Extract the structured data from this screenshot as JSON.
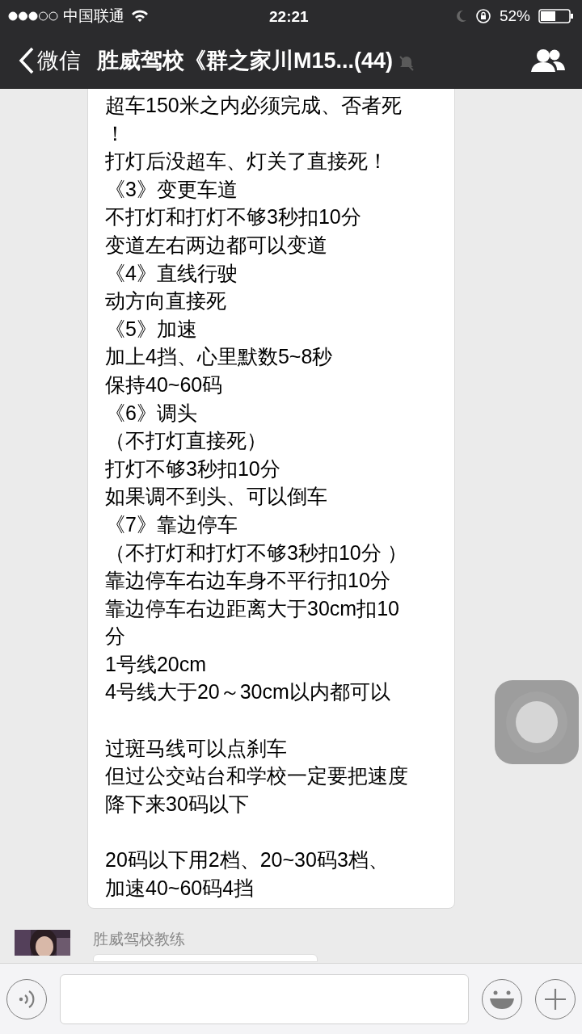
{
  "status_bar": {
    "carrier": "中国联通",
    "time": "22:21",
    "battery": "52%"
  },
  "header": {
    "back": "微信",
    "title": "胜威驾校《群之家川M15...(44)",
    "muted": true
  },
  "message": {
    "paragraphs": [
      [
        "超车150米之内必须完成、否者死",
        "！",
        "打灯后没超车、灯关了直接死！",
        "《3》变更车道",
        "不打灯和打灯不够3秒扣10分",
        "变道左右两边都可以变道",
        "《4》直线行驶",
        "动方向直接死",
        "《5》加速",
        "加上4挡、心里默数5~8秒",
        "保持40~60码",
        "《6》调头",
        "（不打灯直接死）",
        "打灯不够3秒扣10分",
        "如果调不到头、可以倒车",
        "《7》靠边停车",
        "（不打灯和打灯不够3秒扣10分 ）",
        "靠边停车右边车身不平行扣10分",
        "靠边停车右边距离大于30cm扣10",
        "分",
        "1号线20cm",
        "4号线大于20～30cm以内都可以"
      ],
      [
        "过斑马线可以点刹车",
        "但过公交站台和学校一定要把速度",
        "降下来30码以下"
      ],
      [
        "20码以下用2档、20~30码3档、",
        "加速40~60码4挡"
      ]
    ]
  },
  "next_message": {
    "sender": "胜威驾校教练"
  }
}
